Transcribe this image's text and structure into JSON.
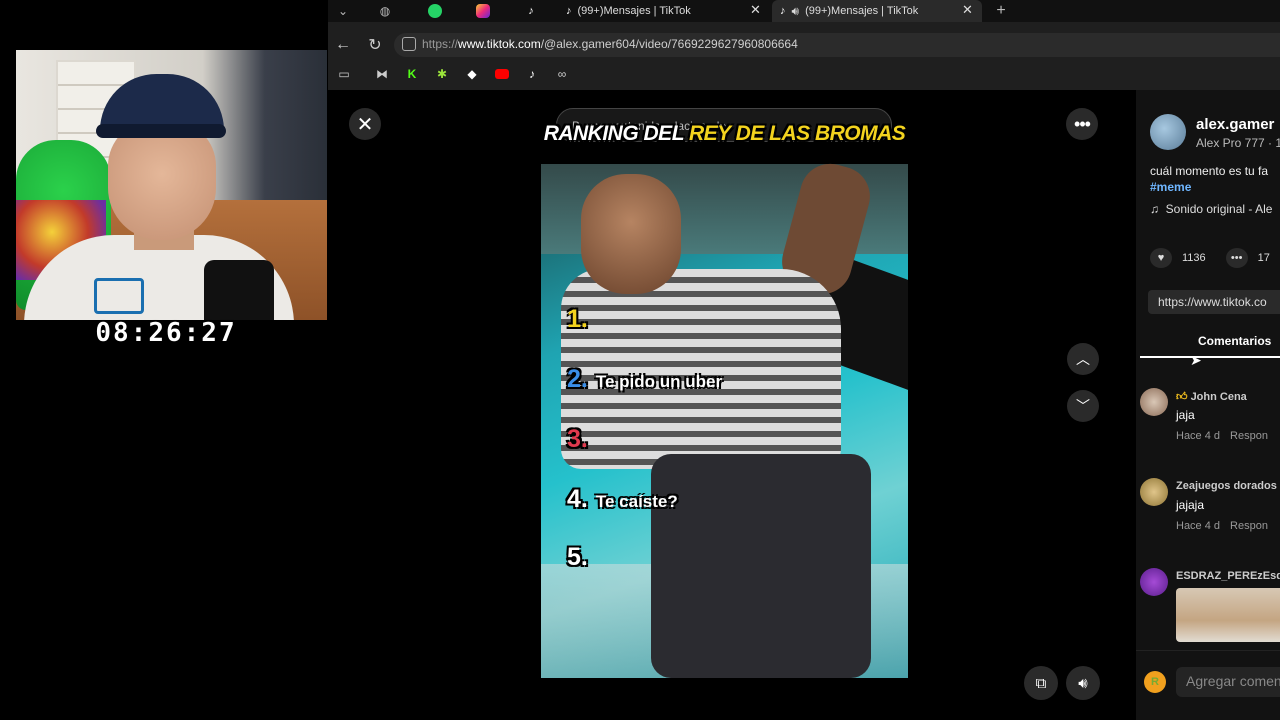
{
  "webcam": {
    "timer": "08:26:27"
  },
  "browser": {
    "tabs": [
      {
        "title": "(99+)Mensajes | TikTok"
      },
      {
        "title": "(99+)Mensajes | TikTok"
      }
    ],
    "url_prefix": "https://",
    "url_domain": "www.tiktok.com",
    "url_path": "/@alex.gamer604/video/7669229627960806664"
  },
  "video": {
    "search_placeholder": "Busca contenido relacionado",
    "banner_white": "RANKING DEL",
    "banner_yellow": "REY DE LAS BROMAS",
    "ranking": [
      {
        "num": "1.",
        "text": "",
        "color": "#f3d31e"
      },
      {
        "num": "2.",
        "text": "Te pido un uber",
        "color": "#3a8ee8"
      },
      {
        "num": "3.",
        "text": "",
        "color": "#e03a4e"
      },
      {
        "num": "4.",
        "text": "Te caíste?",
        "color": "#ffffff"
      },
      {
        "num": "5.",
        "text": "",
        "color": "#ffffff"
      }
    ]
  },
  "panel": {
    "username": "alex.gamer",
    "nickname": "Alex Pro 777 · 1",
    "description": "cuál momento es tu fa",
    "hashtag": "#meme",
    "sound": "Sonido original - Ale",
    "likes": "1136",
    "comments_count": "17",
    "link": "https://www.tiktok.co",
    "tab_label": "Comentarios",
    "comments": [
      {
        "name": "John Cena",
        "text": "jaja",
        "time": "Hace 4 d",
        "reply": "Respon"
      },
      {
        "name": "Zeajuegos dorados",
        "text": "jajaja",
        "time": "Hace 4 d",
        "reply": "Respon"
      },
      {
        "name": "ESDRAZ_PEREzEsd",
        "text": "",
        "time": "",
        "reply": ""
      }
    ],
    "add_comment_placeholder": "Agregar comen"
  }
}
